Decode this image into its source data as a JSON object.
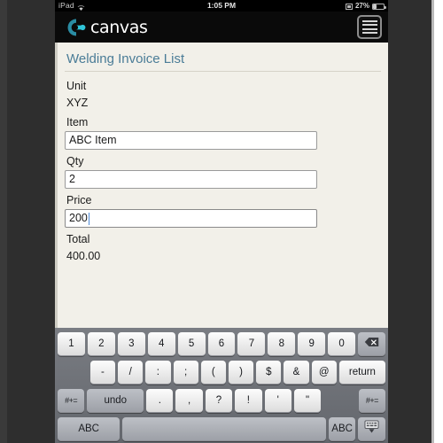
{
  "status_bar": {
    "device": "iPad",
    "wifi_icon": "wifi-icon",
    "time": "1:05 PM",
    "sync_icon": "sync-icon",
    "battery_percent": "27%",
    "battery_icon": "battery-icon"
  },
  "app_header": {
    "logo_icon": "canvas-logo-icon",
    "logo_text": "canvas",
    "menu_icon": "hamburger-menu-icon"
  },
  "form": {
    "title": "Welding Invoice List",
    "fields": [
      {
        "label": "Unit",
        "type": "static",
        "value": "XYZ"
      },
      {
        "label": "Item",
        "type": "input",
        "value": "ABC Item",
        "focused": false
      },
      {
        "label": "Qty",
        "type": "input",
        "value": "2",
        "focused": false
      },
      {
        "label": "Price",
        "type": "input",
        "value": "200",
        "focused": true
      },
      {
        "label": "Total",
        "type": "static",
        "value": "400.00"
      }
    ]
  },
  "keyboard": {
    "rows": [
      {
        "keys": [
          {
            "label": "1",
            "name": "key-1",
            "style": "light"
          },
          {
            "label": "2",
            "name": "key-2",
            "style": "light"
          },
          {
            "label": "3",
            "name": "key-3",
            "style": "light"
          },
          {
            "label": "4",
            "name": "key-4",
            "style": "light"
          },
          {
            "label": "5",
            "name": "key-5",
            "style": "light"
          },
          {
            "label": "6",
            "name": "key-6",
            "style": "light"
          },
          {
            "label": "7",
            "name": "key-7",
            "style": "light"
          },
          {
            "label": "8",
            "name": "key-8",
            "style": "light"
          },
          {
            "label": "9",
            "name": "key-9",
            "style": "light"
          },
          {
            "label": "0",
            "name": "key-0",
            "style": "light"
          },
          {
            "label": "",
            "name": "key-backspace",
            "style": "dark",
            "icon": "backspace-icon"
          }
        ]
      },
      {
        "keys": [
          {
            "label": "-",
            "name": "key-hyphen",
            "style": "light"
          },
          {
            "label": "/",
            "name": "key-slash",
            "style": "light"
          },
          {
            "label": ":",
            "name": "key-colon",
            "style": "light"
          },
          {
            "label": ";",
            "name": "key-semicolon",
            "style": "light"
          },
          {
            "label": "(",
            "name": "key-paren-open",
            "style": "light"
          },
          {
            "label": ")",
            "name": "key-paren-close",
            "style": "light"
          },
          {
            "label": "$",
            "name": "key-dollar",
            "style": "light"
          },
          {
            "label": "&",
            "name": "key-ampersand",
            "style": "light"
          },
          {
            "label": "@",
            "name": "key-at",
            "style": "light"
          },
          {
            "label": "return",
            "name": "key-return",
            "style": "light"
          }
        ]
      },
      {
        "keys": [
          {
            "label": "#+=",
            "name": "key-symbols-left",
            "style": "dark"
          },
          {
            "label": "undo",
            "name": "key-undo",
            "style": "dark"
          },
          {
            "label": ".",
            "name": "key-period",
            "style": "light"
          },
          {
            "label": ",",
            "name": "key-comma",
            "style": "light"
          },
          {
            "label": "?",
            "name": "key-question",
            "style": "light"
          },
          {
            "label": "!",
            "name": "key-exclamation",
            "style": "light"
          },
          {
            "label": "'",
            "name": "key-apostrophe",
            "style": "light"
          },
          {
            "label": "\"",
            "name": "key-quote",
            "style": "light"
          },
          {
            "label": "#+=",
            "name": "key-symbols-right",
            "style": "dark"
          }
        ]
      },
      {
        "keys": [
          {
            "label": "ABC",
            "name": "key-abc-left",
            "style": "dark"
          },
          {
            "label": "",
            "name": "key-space",
            "style": "dark"
          },
          {
            "label": "ABC",
            "name": "key-abc-right",
            "style": "dark"
          },
          {
            "label": "",
            "name": "key-hide-keyboard",
            "style": "dark",
            "icon": "hide-keyboard-icon"
          }
        ]
      }
    ]
  },
  "colors": {
    "accent_title": "#4a7c97",
    "logo_teal": "#2fc4d8",
    "logo_ring": "#2a8ca3",
    "panel_bg": "#f2f0e9",
    "keyboard_bg": "#6d7076",
    "caret": "#4f8ad6"
  }
}
